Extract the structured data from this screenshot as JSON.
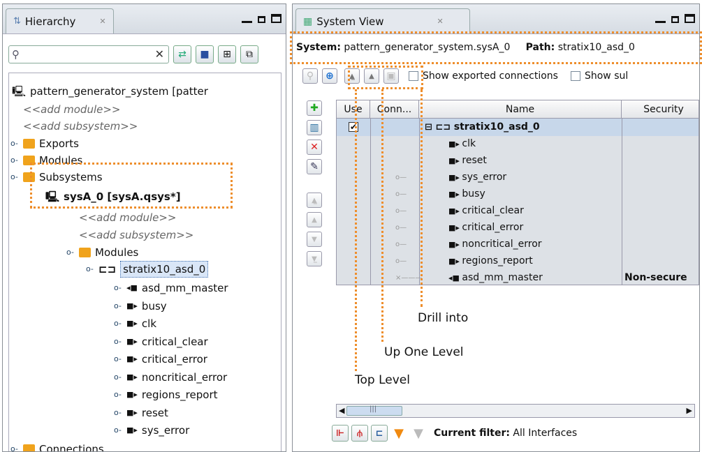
{
  "hierarchy": {
    "tab_title": "Hierarchy",
    "search_placeholder": "",
    "tree": {
      "root": "pattern_generator_system  [patter",
      "add_module": "<<add module>>",
      "add_subsystem": "<<add subsystem>>",
      "exports": "Exports",
      "modules": "Modules",
      "subsystems": "Subsystems",
      "sub_system": "sysA_0  [sysA.qsys*]",
      "sub_add_module": "<<add module>>",
      "sub_add_subsystem": "<<add subsystem>>",
      "sub_modules": "Modules",
      "selected_module": "stratix10_asd_0",
      "interfaces": [
        "asd_mm_master",
        "busy",
        "clk",
        "critical_clear",
        "critical_error",
        "noncritical_error",
        "regions_report",
        "reset",
        "sys_error"
      ],
      "connections": "Connections"
    }
  },
  "system_view": {
    "tab_title": "System View",
    "system_label": "System:",
    "system_value": "pattern_generator_system.sysA_0",
    "path_label": "Path:",
    "path_value": "stratix10_asd_0",
    "show_exported": "Show exported connections",
    "show_sub": "Show sul",
    "columns": {
      "use": "Use",
      "conn": "Conn...",
      "name": "Name",
      "security": "Security"
    },
    "rows": [
      {
        "name": "stratix10_asd_0",
        "security": "",
        "use": "checked",
        "kind": "module"
      },
      {
        "name": "clk",
        "security": "",
        "kind": "in"
      },
      {
        "name": "reset",
        "security": "",
        "kind": "in"
      },
      {
        "name": "sys_error",
        "security": "",
        "kind": "in"
      },
      {
        "name": "busy",
        "security": "",
        "kind": "in"
      },
      {
        "name": "critical_clear",
        "security": "",
        "kind": "in"
      },
      {
        "name": "critical_error",
        "security": "",
        "kind": "in"
      },
      {
        "name": "noncritical_error",
        "security": "",
        "kind": "in"
      },
      {
        "name": "regions_report",
        "security": "",
        "kind": "in"
      },
      {
        "name": "asd_mm_master",
        "security": "Non-secure",
        "kind": "out"
      }
    ],
    "filter_label": "Current filter:",
    "filter_value": "All Interfaces",
    "scroll_mark": "|||"
  },
  "annotations": {
    "drill_into": "Drill into",
    "up_one_level": "Up One Level",
    "top_level": "Top Level"
  },
  "colors": {
    "highlight": "#ee8e2c",
    "folder": "#f0a31c",
    "selection": "#c7d7ea"
  }
}
